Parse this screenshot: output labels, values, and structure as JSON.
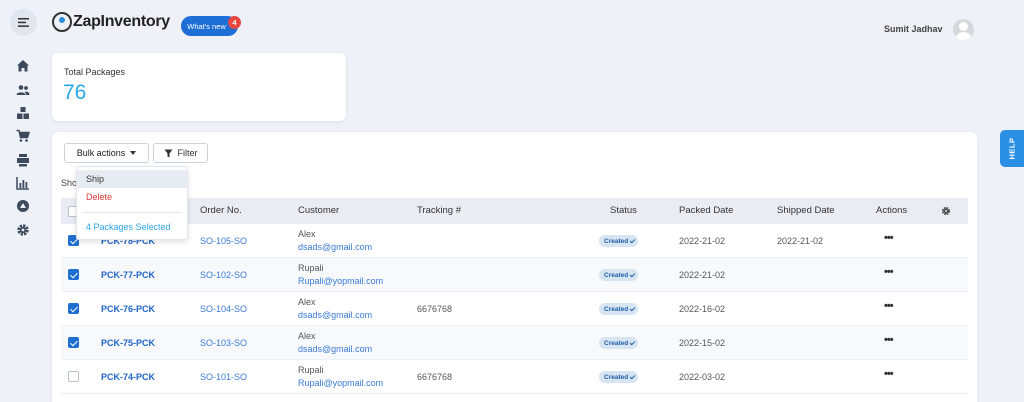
{
  "app": {
    "logo_text": "ZapInventory"
  },
  "header": {
    "whats_new_label": "What's new",
    "whats_new_count": "4",
    "user_name": "Sumit Jadhav"
  },
  "sidebar": {
    "items": [
      {
        "icon": "home-icon"
      },
      {
        "icon": "users-icon"
      },
      {
        "icon": "boxes-icon"
      },
      {
        "icon": "cart-icon"
      },
      {
        "icon": "truck-icon"
      },
      {
        "icon": "chart-icon"
      },
      {
        "icon": "circle-icon"
      },
      {
        "icon": "gear-icon"
      }
    ]
  },
  "summary": {
    "label": "Total Packages",
    "value": "76"
  },
  "toolbar": {
    "bulk_label": "Bulk actions",
    "filter_label": "Filter",
    "show_label": "Sho"
  },
  "dropdown": {
    "ship": "Ship",
    "delete": "Delete",
    "selected": "4 Packages Selected"
  },
  "table": {
    "columns": {
      "order": "Order No.",
      "customer": "Customer",
      "tracking": "Tracking #",
      "status": "Status",
      "packed": "Packed Date",
      "shipped": "Shipped Date",
      "actions": "Actions"
    },
    "rows": [
      {
        "checked": true,
        "package": "PCK-78-PCK",
        "order": "SO-105-SO",
        "name": "Alex",
        "email": "dsads@gmail.com",
        "tracking": "",
        "status": "Created",
        "packed": "2022-21-02",
        "shipped": "2022-21-02",
        "actions": "•••"
      },
      {
        "checked": true,
        "package": "PCK-77-PCK",
        "order": "SO-102-SO",
        "name": "Rupali",
        "email": "Rupali@yopmail.com",
        "tracking": "",
        "status": "Created",
        "packed": "2022-21-02",
        "shipped": "",
        "actions": "•••"
      },
      {
        "checked": true,
        "package": "PCK-76-PCK",
        "order": "SO-104-SO",
        "name": "Alex",
        "email": "dsads@gmail.com",
        "tracking": "6676768",
        "status": "Created",
        "packed": "2022-16-02",
        "shipped": "",
        "actions": "•••"
      },
      {
        "checked": true,
        "package": "PCK-75-PCK",
        "order": "SO-103-SO",
        "name": "Alex",
        "email": "dsads@gmail.com",
        "tracking": "",
        "status": "Created",
        "packed": "2022-15-02",
        "shipped": "",
        "actions": "•••"
      },
      {
        "checked": false,
        "package": "PCK-74-PCK",
        "order": "SO-101-SO",
        "name": "Rupali",
        "email": "Rupali@yopmail.com",
        "tracking": "6676768",
        "status": "Created",
        "packed": "2022-03-02",
        "shipped": "",
        "actions": "•••"
      }
    ]
  },
  "help": {
    "label": "HELP"
  },
  "colors": {
    "accent": "#2aa7e8",
    "primary": "#1f6fd1",
    "danger": "#e23b3b"
  }
}
